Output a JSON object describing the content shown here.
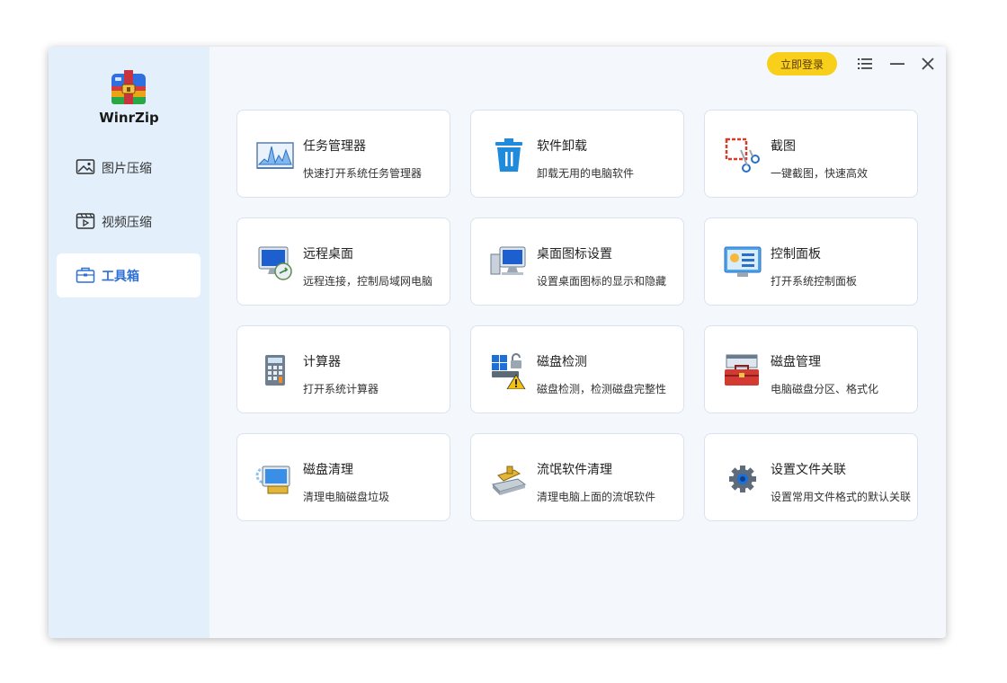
{
  "app": {
    "name": "WinrZip"
  },
  "header": {
    "login_label": "立即登录"
  },
  "sidebar": {
    "items": [
      {
        "label": "图片压缩",
        "icon": "image-icon",
        "active": false
      },
      {
        "label": "视频压缩",
        "icon": "video-icon",
        "active": false
      },
      {
        "label": "工具箱",
        "icon": "toolbox-icon",
        "active": true
      }
    ]
  },
  "tools": [
    {
      "title": "任务管理器",
      "desc": "快速打开系统任务管理器",
      "icon": "task-manager-icon"
    },
    {
      "title": "软件卸载",
      "desc": "卸载无用的电脑软件",
      "icon": "trash-icon"
    },
    {
      "title": "截图",
      "desc": "一键截图，快速高效",
      "icon": "screenshot-icon"
    },
    {
      "title": "远程桌面",
      "desc": "远程连接，控制局域网电脑",
      "icon": "remote-desktop-icon"
    },
    {
      "title": "桌面图标设置",
      "desc": "设置桌面图标的显示和隐藏",
      "icon": "desktop-icon-settings-icon"
    },
    {
      "title": "控制面板",
      "desc": "打开系统控制面板",
      "icon": "control-panel-icon"
    },
    {
      "title": "计算器",
      "desc": "打开系统计算器",
      "icon": "calculator-icon"
    },
    {
      "title": "磁盘检测",
      "desc": "磁盘检测，检测磁盘完整性",
      "icon": "disk-check-icon"
    },
    {
      "title": "磁盘管理",
      "desc": "电脑磁盘分区、格式化",
      "icon": "disk-management-icon"
    },
    {
      "title": "磁盘清理",
      "desc": "清理电脑磁盘垃圾",
      "icon": "disk-cleanup-icon"
    },
    {
      "title": "流氓软件清理",
      "desc": "清理电脑上面的流氓软件",
      "icon": "rogue-software-cleanup-icon"
    },
    {
      "title": "设置文件关联",
      "desc": "设置常用文件格式的默认关联",
      "icon": "file-association-gear-icon"
    }
  ]
}
